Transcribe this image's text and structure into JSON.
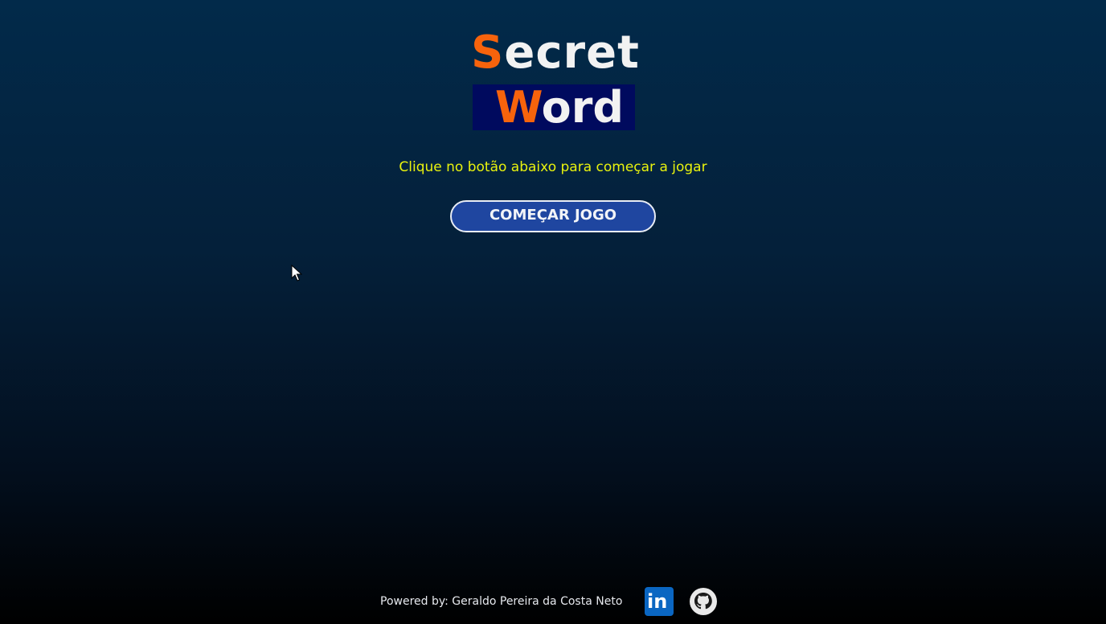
{
  "logo": {
    "line1_initial": "S",
    "line1_rest": "ecret",
    "line2_initial": "W",
    "line2_rest": "ord"
  },
  "subtitle": "Clique no botão abaixo para começar a jogar",
  "start_button": {
    "label": "COMEÇAR JOGO"
  },
  "footer": {
    "credit": "Powered by: Geraldo Pereira da Costa Neto",
    "linkedin_icon": "linkedin-icon",
    "github_icon": "github-icon"
  },
  "colors": {
    "accent_orange": "#f7630c",
    "subtitle_yellow": "#e8f20e",
    "button_blue": "#1f46a0",
    "logo_word_bg": "#000a5e",
    "linkedin_blue": "#0a66c2"
  }
}
